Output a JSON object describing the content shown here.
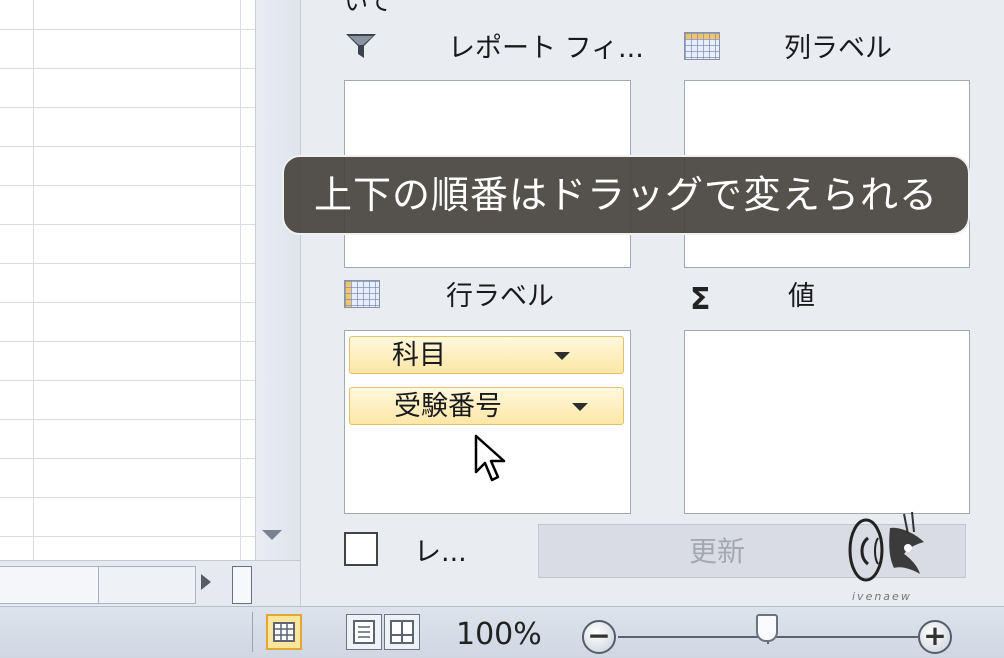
{
  "pane": {
    "top_cut_text": "いて",
    "areas": {
      "report_filter": {
        "label": "レポート フィ..."
      },
      "column_labels": {
        "label": "列ラベル"
      },
      "row_labels": {
        "label": "行ラベル",
        "fields": [
          "科目",
          "受験番号"
        ]
      },
      "values": {
        "label": "値",
        "icon": "sigma-icon"
      }
    },
    "defer_update": {
      "label": "レ...",
      "checked": false
    },
    "update_button": {
      "label": "更新",
      "enabled": false
    }
  },
  "tooltip": {
    "text": "上下の順番はドラッグで変えられる"
  },
  "status_bar": {
    "zoom": "100%",
    "zoom_out": "−",
    "zoom_in": "+",
    "zoom_level_percent": 100,
    "active_view": "normal"
  },
  "watermark": {
    "text": "ivenaew"
  },
  "colors": {
    "pane_bg": "#e9edf2",
    "field_chip": "#fde7a6",
    "tooltip_bg": "#484440"
  }
}
